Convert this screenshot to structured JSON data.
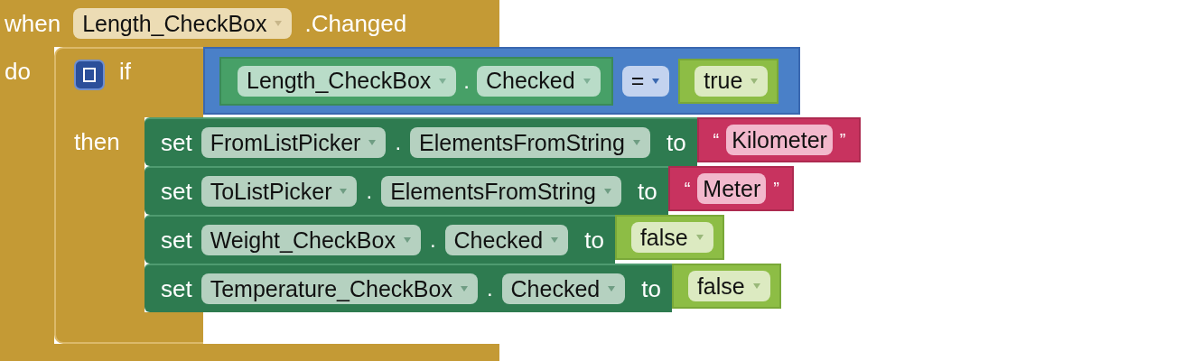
{
  "event": {
    "keyword": "when",
    "component": "Length_CheckBox",
    "event": ".Changed",
    "do_label": "do",
    "if_block": {
      "keyword": "if",
      "then_label": "then",
      "condition": {
        "left": {
          "kind": "getter",
          "component": "Length_CheckBox",
          "separator": ".",
          "property": "Checked"
        },
        "operator": "=",
        "right": {
          "kind": "boolean",
          "value": "true"
        }
      },
      "statements": [
        {
          "keyword": "set",
          "component": "FromListPicker",
          "separator": ".",
          "property": "ElementsFromString",
          "to": "to",
          "value": {
            "kind": "text",
            "open_quote": "“",
            "text": "Kilometer",
            "close_quote": "”"
          }
        },
        {
          "keyword": "set",
          "component": "ToListPicker",
          "separator": ".",
          "property": "ElementsFromString",
          "to": "to",
          "value": {
            "kind": "text",
            "open_quote": "“",
            "text": "Meter",
            "close_quote": "”"
          }
        },
        {
          "keyword": "set",
          "component": "Weight_CheckBox",
          "separator": ".",
          "property": "Checked",
          "to": "to",
          "value": {
            "kind": "boolean",
            "value": "false"
          }
        },
        {
          "keyword": "set",
          "component": "Temperature_CheckBox",
          "separator": ".",
          "property": "Checked",
          "to": "to",
          "value": {
            "kind": "boolean",
            "value": "false"
          }
        }
      ]
    }
  }
}
